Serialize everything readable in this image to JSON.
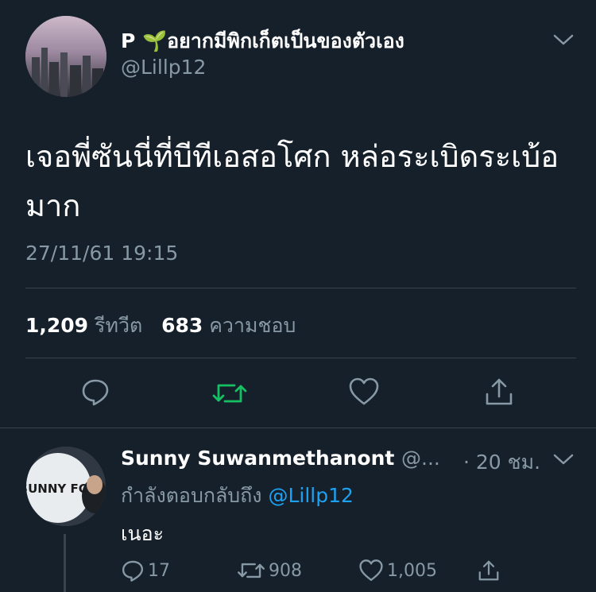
{
  "tweet": {
    "author_name": "P 🌱อยากมีพิกเก็ตเป็นของตัวเอง",
    "author_handle": "@Lillp12",
    "text": "เจอพี่ซันนี่ที่บีทีเอสอโศก หล่อระเบิดระเบ้อมาก",
    "timestamp": "27/11/61 19:15",
    "retweet_count": "1,209",
    "retweet_label": "รีทวีต",
    "like_count": "683",
    "like_label": "ความชอบ"
  },
  "reply": {
    "author_name": "Sunny Suwanmethanont",
    "author_handle": "@...",
    "time": "· 20 ชม.",
    "replying_prefix": "กำลังตอบกลับถึง",
    "replying_mention": "@Lillp12",
    "text": "เนอะ",
    "reply_count": "17",
    "retweet_count": "908",
    "like_count": "1,005",
    "avatar_text": "SUNNY FC"
  },
  "colors": {
    "background": "#15202b",
    "secondary_text": "#8899a6",
    "retweet_green": "#17bf63",
    "link_blue": "#1da1f2",
    "divider": "#38444d"
  },
  "icons": [
    "reply-icon",
    "retweet-icon",
    "like-icon",
    "share-icon",
    "chevron-down-icon"
  ]
}
